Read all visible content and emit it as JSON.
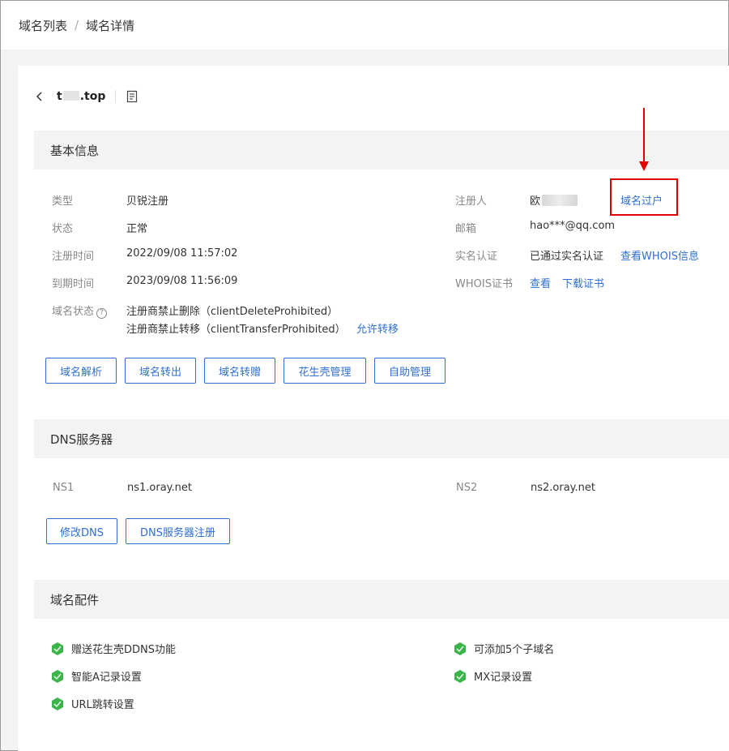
{
  "breadcrumb": {
    "items": [
      "域名列表",
      "域名详情"
    ],
    "separator": "/"
  },
  "domain": {
    "prefix": "t",
    "suffix": ".top"
  },
  "basic": {
    "title": "基本信息",
    "left": [
      {
        "label": "类型",
        "value": "贝锐注册"
      },
      {
        "label": "状态",
        "value": "正常"
      },
      {
        "label": "注册时间",
        "value": "2022/09/08 11:57:02"
      },
      {
        "label": "到期时间",
        "value": "2023/09/08 11:56:09"
      }
    ],
    "domain_status": {
      "label": "域名状态",
      "help_icon": "question-circle-icon",
      "line1": "注册商禁止删除（clientDeleteProhibited）",
      "line2": "注册商禁止转移（clientTransferProhibited）",
      "allow_transfer": "允许转移"
    },
    "registrant": {
      "label": "注册人",
      "value": "欧",
      "action": "域名过户"
    },
    "email": {
      "label": "邮箱",
      "value": "hao***@qq.com"
    },
    "verification": {
      "label": "实名认证",
      "value": "已通过实名认证",
      "action": "查看WHOIS信息"
    },
    "whois_cert": {
      "label": "WHOIS证书",
      "view": "查看",
      "download": "下载证书"
    },
    "buttons": [
      "域名解析",
      "域名转出",
      "域名转赠",
      "花生壳管理",
      "自助管理"
    ]
  },
  "dns": {
    "title": "DNS服务器",
    "ns1": {
      "label": "NS1",
      "value": "ns1.oray.net"
    },
    "ns2": {
      "label": "NS2",
      "value": "ns2.oray.net"
    },
    "buttons": [
      "修改DNS",
      "DNS服务器注册"
    ]
  },
  "accessories": {
    "title": "域名配件",
    "left": [
      "赠送花生壳DDNS功能",
      "智能A记录设置",
      "URL跳转设置"
    ],
    "right": [
      "可添加5个子域名",
      "MX记录设置"
    ]
  },
  "colors": {
    "link": "#2f6fd1",
    "annotation": "#e00000",
    "header_bg": "#f2f3f5"
  }
}
